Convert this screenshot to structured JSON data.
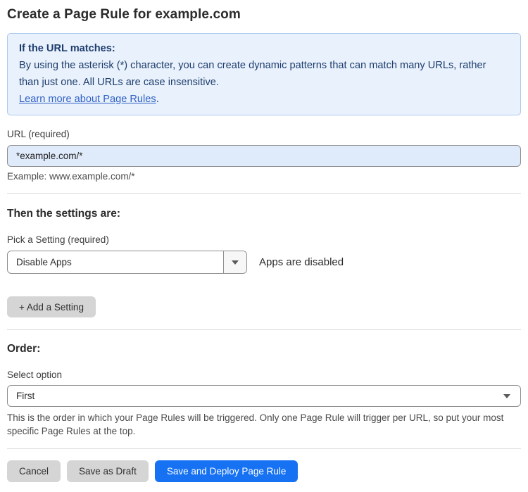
{
  "page": {
    "title": "Create a Page Rule for example.com"
  },
  "info_box": {
    "heading": "If the URL matches:",
    "body": "By using the asterisk (*) character, you can create dynamic patterns that can match many URLs, rather than just one. All URLs are case insensitive.",
    "link_label": "Learn more about Page Rules",
    "link_suffix": "."
  },
  "url_field": {
    "label": "URL (required)",
    "value": "*example.com/*",
    "helper": "Example: www.example.com/*"
  },
  "settings_section": {
    "heading": "Then the settings are:",
    "setting_label": "Pick a Setting (required)",
    "setting_value": "Disable Apps",
    "setting_status": "Apps are disabled",
    "add_setting_label": "+ Add a Setting"
  },
  "order_section": {
    "heading": "Order:",
    "select_label": "Select option",
    "select_value": "First",
    "helper": "This is the order in which your Page Rules will be triggered. Only one Page Rule will trigger per URL, so put your most specific Page Rules at the top."
  },
  "actions": {
    "cancel_label": "Cancel",
    "save_draft_label": "Save as Draft",
    "save_deploy_label": "Save and Deploy Page Rule"
  },
  "colors": {
    "info_bg": "#e9f2fc",
    "info_border": "#abc9ee",
    "info_text": "#1e3c6e",
    "link_blue": "#2f5fc4",
    "input_bg": "#dfeafa",
    "primary_button_bg": "#1672f3",
    "gray_button_bg": "#d5d5d5"
  },
  "icons": {
    "setting_dropdown_caret": "caret-down",
    "order_select_caret": "caret-down"
  }
}
